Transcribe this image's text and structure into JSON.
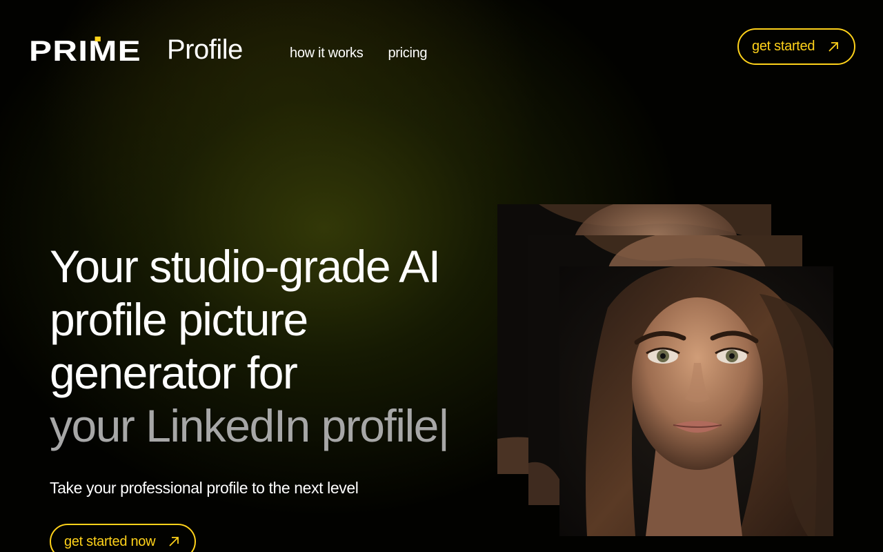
{
  "header": {
    "logo": {
      "prime": "PRIME",
      "profile": "Profile"
    },
    "nav": [
      {
        "label": "how it works"
      },
      {
        "label": "pricing"
      }
    ],
    "cta_label": "get started"
  },
  "hero": {
    "headline_lines": [
      "Your studio-grade AI",
      "profile picture",
      "generator for"
    ],
    "headline_highlight": "your LinkedIn profile",
    "cursor": "|",
    "subtitle": "Take your professional profile to the next level",
    "cta_label": "get started now"
  },
  "colors": {
    "accent": "#ffd21a",
    "background": "#000000",
    "highlight_text": "#a7a7a7"
  },
  "icons": [
    "arrow-up-right-icon"
  ]
}
